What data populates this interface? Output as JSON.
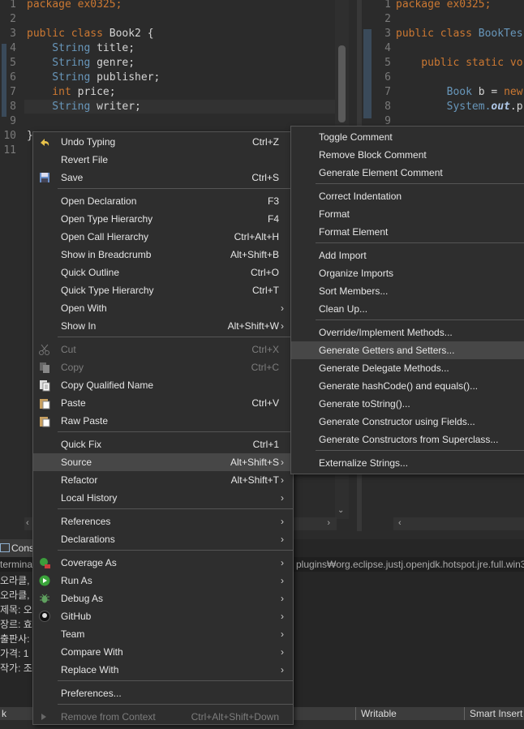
{
  "editor_left": {
    "line_numbers": [
      "1",
      "2",
      "3",
      "4",
      "5",
      "6",
      "7",
      "8",
      "9",
      "10",
      "11"
    ],
    "lines": [
      [
        {
          "t": "package ex0325;",
          "c": "kw0"
        }
      ],
      [],
      [
        {
          "t": "public class ",
          "c": "kw"
        },
        {
          "t": "Book2 {",
          "c": "plain"
        }
      ],
      [
        {
          "t": "    String ",
          "c": "ty"
        },
        {
          "t": "title;",
          "c": "plain"
        }
      ],
      [
        {
          "t": "    String ",
          "c": "ty"
        },
        {
          "t": "genre;",
          "c": "plain"
        }
      ],
      [
        {
          "t": "    String ",
          "c": "ty"
        },
        {
          "t": "publisher;",
          "c": "plain"
        }
      ],
      [
        {
          "t": "    int ",
          "c": "kw"
        },
        {
          "t": "price;",
          "c": "plain"
        }
      ],
      [
        {
          "t": "    String ",
          "c": "ty"
        },
        {
          "t": "writer;",
          "c": "plain"
        }
      ],
      [],
      [
        {
          "t": "}",
          "c": "plain"
        }
      ],
      []
    ]
  },
  "editor_right": {
    "line_numbers": [
      "1",
      "2",
      "3",
      "4",
      "5",
      "6",
      "7",
      "8",
      "9"
    ],
    "lines": [
      [
        {
          "t": "package ex0325;",
          "c": "kw0"
        }
      ],
      [],
      [
        {
          "t": "public class ",
          "c": "kw"
        },
        {
          "t": "BookTes",
          "c": "ty"
        }
      ],
      [],
      [
        {
          "t": "    public static vo",
          "c": "kw"
        }
      ],
      [],
      [
        {
          "t": "        Book ",
          "c": "ty"
        },
        {
          "t": "b = ",
          "c": "plain"
        },
        {
          "t": "new",
          "c": "kw"
        }
      ],
      [
        {
          "t": "        System.",
          "c": "ty"
        },
        {
          "t": "out",
          "c": "fi"
        },
        {
          "t": ".p",
          "c": "plain"
        }
      ],
      []
    ]
  },
  "console": {
    "tab_label": "Cons",
    "header": "termina",
    "header_right": "plugins₩org.eclipse.justj.openjdk.hotspot.jre.full.win3",
    "lines": [
      "오라클,",
      "오라클,",
      "제목: 오",
      "장르: 효",
      "출판사:",
      "가격: 1",
      "작가: 조"
    ]
  },
  "statusbar": {
    "left": "k",
    "writable": "Writable",
    "insert_mode": "Smart Insert"
  },
  "context_menu": {
    "items": [
      {
        "label": "Undo Typing",
        "shortcut": "Ctrl+Z",
        "icon": "undo-icon"
      },
      {
        "label": "Revert File",
        "shortcut": ""
      },
      {
        "label": "Save",
        "shortcut": "Ctrl+S",
        "icon": "save-icon"
      },
      {
        "label": "Open Declaration",
        "shortcut": "F3"
      },
      {
        "label": "Open Type Hierarchy",
        "shortcut": "F4"
      },
      {
        "label": "Open Call Hierarchy",
        "shortcut": "Ctrl+Alt+H"
      },
      {
        "label": "Show in Breadcrumb",
        "shortcut": "Alt+Shift+B"
      },
      {
        "label": "Quick Outline",
        "shortcut": "Ctrl+O"
      },
      {
        "label": "Quick Type Hierarchy",
        "shortcut": "Ctrl+T"
      },
      {
        "label": "Open With",
        "shortcut": "",
        "submenu": true
      },
      {
        "label": "Show In",
        "shortcut": "Alt+Shift+W",
        "submenu": true
      },
      {
        "label": "Cut",
        "shortcut": "Ctrl+X",
        "disabled": true,
        "icon": "cut-icon"
      },
      {
        "label": "Copy",
        "shortcut": "Ctrl+C",
        "disabled": true,
        "icon": "copy-icon"
      },
      {
        "label": "Copy Qualified Name",
        "shortcut": "",
        "icon": "copy-qualified-icon"
      },
      {
        "label": "Paste",
        "shortcut": "Ctrl+V",
        "icon": "paste-icon"
      },
      {
        "label": "Raw Paste",
        "shortcut": "",
        "icon": "raw-paste-icon"
      },
      {
        "label": "Quick Fix",
        "shortcut": "Ctrl+1"
      },
      {
        "label": "Source",
        "shortcut": "Alt+Shift+S",
        "submenu": true,
        "highlighted": true
      },
      {
        "label": "Refactor",
        "shortcut": "Alt+Shift+T",
        "submenu": true
      },
      {
        "label": "Local History",
        "shortcut": "",
        "submenu": true
      },
      {
        "label": "References",
        "shortcut": "",
        "submenu": true
      },
      {
        "label": "Declarations",
        "shortcut": "",
        "submenu": true
      },
      {
        "label": "Coverage As",
        "shortcut": "",
        "submenu": true,
        "icon": "coverage-icon"
      },
      {
        "label": "Run As",
        "shortcut": "",
        "submenu": true,
        "icon": "run-icon"
      },
      {
        "label": "Debug As",
        "shortcut": "",
        "submenu": true,
        "icon": "debug-icon"
      },
      {
        "label": "GitHub",
        "shortcut": "",
        "submenu": true,
        "icon": "github-icon"
      },
      {
        "label": "Team",
        "shortcut": "",
        "submenu": true
      },
      {
        "label": "Compare With",
        "shortcut": "",
        "submenu": true
      },
      {
        "label": "Replace With",
        "shortcut": "",
        "submenu": true
      },
      {
        "label": "Preferences...",
        "shortcut": ""
      },
      {
        "label": "Remove from Context",
        "shortcut": "Ctrl+Alt+Shift+Down",
        "disabled": true,
        "icon": "remove-context-icon"
      }
    ]
  },
  "source_submenu": {
    "items": [
      {
        "label": "Toggle Comment"
      },
      {
        "label": "Remove Block Comment"
      },
      {
        "label": "Generate Element Comment"
      },
      {
        "label": "Correct Indentation"
      },
      {
        "label": "Format"
      },
      {
        "label": "Format Element"
      },
      {
        "label": "Add Import"
      },
      {
        "label": "Organize Imports"
      },
      {
        "label": "Sort Members..."
      },
      {
        "label": "Clean Up..."
      },
      {
        "label": "Override/Implement Methods..."
      },
      {
        "label": "Generate Getters and Setters...",
        "highlighted": true
      },
      {
        "label": "Generate Delegate Methods..."
      },
      {
        "label": "Generate hashCode() and equals()..."
      },
      {
        "label": "Generate toString()..."
      },
      {
        "label": "Generate Constructor using Fields..."
      },
      {
        "label": "Generate Constructors from Superclass..."
      },
      {
        "label": "Externalize Strings..."
      }
    ]
  }
}
